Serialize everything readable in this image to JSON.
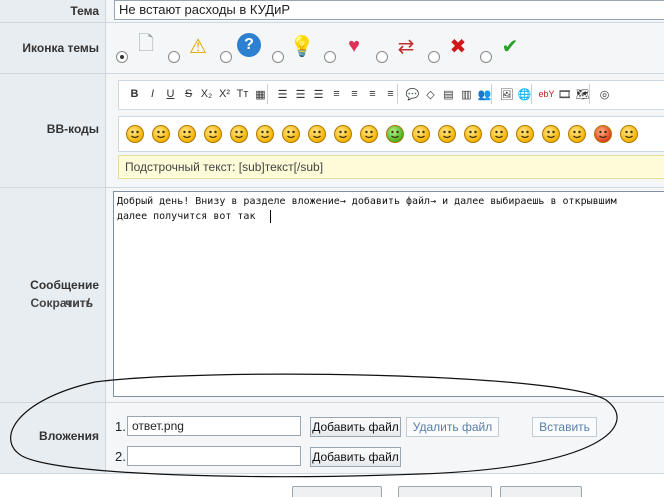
{
  "topic": {
    "label": "Тема",
    "value": "Не встают расходы в КУДиР"
  },
  "icon_row": {
    "label": "Иконка темы",
    "icons": [
      "blank-page-icon",
      "warning-icon",
      "question-icon",
      "lightbulb-icon",
      "heart-icon",
      "exchange-arrows-icon",
      "red-cross-icon",
      "checkmark-icon"
    ]
  },
  "bbcodes": {
    "label": "BB-коды",
    "toolbar": [
      {
        "glyph": "B",
        "name": "bold-icon"
      },
      {
        "glyph": "I",
        "name": "italic-icon"
      },
      {
        "glyph": "U",
        "name": "underline-icon"
      },
      {
        "glyph": "S",
        "name": "strikethrough-icon"
      },
      {
        "glyph": "X₂",
        "name": "subscript-icon"
      },
      {
        "glyph": "X²",
        "name": "superscript-icon"
      },
      {
        "glyph": "Tт",
        "name": "font-size-icon"
      },
      {
        "glyph": "▦",
        "name": "color-palette-icon"
      },
      {
        "glyph": "☰",
        "name": "list-icon"
      },
      {
        "glyph": "☰",
        "name": "numbered-list-icon"
      },
      {
        "glyph": "☰",
        "name": "indent-icon"
      },
      {
        "glyph": "≡",
        "name": "align-left-icon"
      },
      {
        "glyph": "≡",
        "name": "align-center-icon"
      },
      {
        "glyph": "≡",
        "name": "align-right-icon"
      },
      {
        "glyph": "≡",
        "name": "justify-icon"
      },
      {
        "glyph": "💬",
        "name": "quote-icon"
      },
      {
        "glyph": "◇",
        "name": "code-icon"
      },
      {
        "glyph": "▤",
        "name": "table-icon"
      },
      {
        "glyph": "▥",
        "name": "spoiler-icon"
      },
      {
        "glyph": "👥",
        "name": "users-icon"
      },
      {
        "glyph": "🖼",
        "name": "image-icon"
      },
      {
        "glyph": "🌐",
        "name": "link-icon"
      },
      {
        "glyph": "ebY",
        "name": "ebay-icon"
      },
      {
        "glyph": "🎞",
        "name": "video-icon"
      },
      {
        "glyph": "🗺",
        "name": "map-icon"
      },
      {
        "glyph": "◎",
        "name": "web-icon"
      }
    ],
    "smiley_count": 20,
    "hint": "Подстрочный текст: [sub]текст[/sub]"
  },
  "message": {
    "label": "Сообщение",
    "links": {
      "left": "чить",
      "divider": "/",
      "right": "Сократить"
    },
    "text": "Добрый день! Внизу в разделе вложение→ добавить файл→ и далее выбираешь в открывшим\nдалее получится вот так"
  },
  "attachments": {
    "label": "Вложения",
    "rows": [
      {
        "num": "1.",
        "file": "ответ.png",
        "add": "Добавить файл",
        "remove": "Удалить файл",
        "insert": "Вставить"
      },
      {
        "num": "2.",
        "file": "",
        "add": "Добавить файл"
      }
    ]
  }
}
